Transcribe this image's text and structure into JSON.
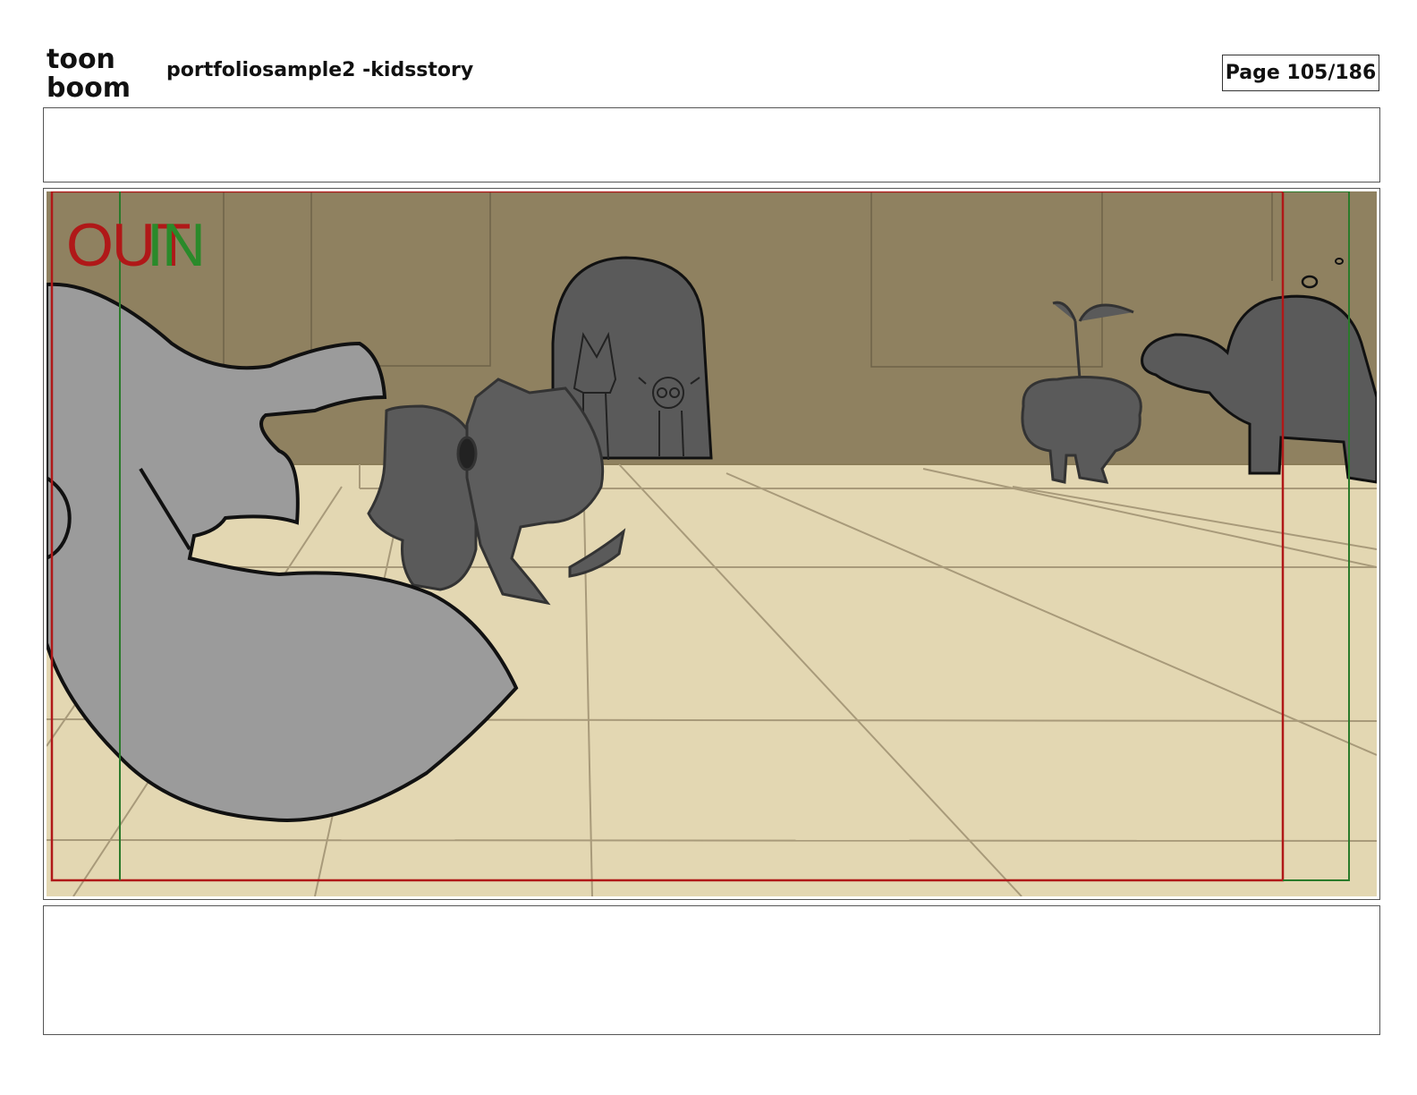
{
  "header": {
    "logo_line1": "toon",
    "logo_line2": "boom",
    "title": "portfoliosample2 -kidsstory",
    "page_label": "Page 105/186"
  },
  "panel": {
    "out_label": "OUT",
    "in_label": "IN",
    "out_color": "#b01818",
    "in_color": "#2a8a2a",
    "wall_color": "#8f8160",
    "floor_color": "#e3d7b2",
    "character_color": "#5a5a5a",
    "foreground_color": "#9b9b9b"
  }
}
